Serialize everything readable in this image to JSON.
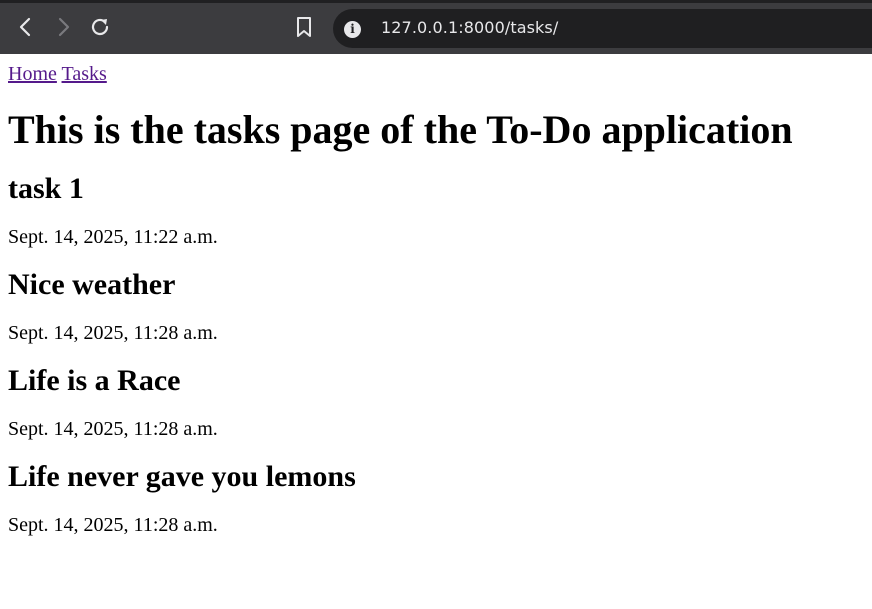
{
  "browser": {
    "url": "127.0.0.1:8000/tasks/"
  },
  "page": {
    "nav_links": [
      "Home",
      "Tasks"
    ],
    "heading": "This is the tasks page of the To-Do application",
    "tasks": [
      {
        "title": "task 1",
        "date": "Sept. 14, 2025, 11:22 a.m."
      },
      {
        "title": "Nice weather",
        "date": "Sept. 14, 2025, 11:28 a.m."
      },
      {
        "title": "Life is a Race",
        "date": "Sept. 14, 2025, 11:28 a.m."
      },
      {
        "title": "Life never gave you lemons",
        "date": "Sept. 14, 2025, 11:28 a.m."
      }
    ]
  }
}
